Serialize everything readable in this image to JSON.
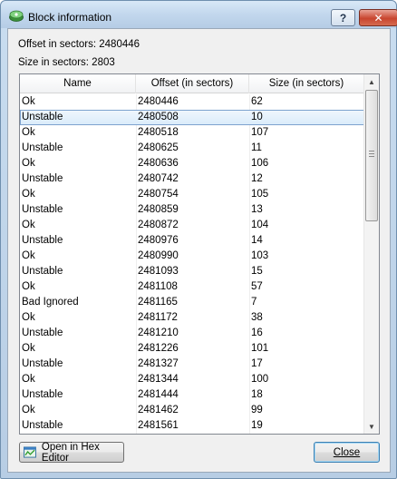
{
  "window": {
    "title": "Block information",
    "help_label": "?",
    "close_label": "✕"
  },
  "info": {
    "offset_line": "Offset in sectors: 2480446",
    "size_line": "Size in sectors: 2803"
  },
  "table": {
    "columns": [
      "Name",
      "Offset (in sectors)",
      "Size (in sectors)"
    ],
    "selected_row": 1,
    "rows": [
      [
        "Ok",
        "2480446",
        "62"
      ],
      [
        "Unstable",
        "2480508",
        "10"
      ],
      [
        "Ok",
        "2480518",
        "107"
      ],
      [
        "Unstable",
        "2480625",
        "11"
      ],
      [
        "Ok",
        "2480636",
        "106"
      ],
      [
        "Unstable",
        "2480742",
        "12"
      ],
      [
        "Ok",
        "2480754",
        "105"
      ],
      [
        "Unstable",
        "2480859",
        "13"
      ],
      [
        "Ok",
        "2480872",
        "104"
      ],
      [
        "Unstable",
        "2480976",
        "14"
      ],
      [
        "Ok",
        "2480990",
        "103"
      ],
      [
        "Unstable",
        "2481093",
        "15"
      ],
      [
        "Ok",
        "2481108",
        "57"
      ],
      [
        "Bad Ignored",
        "2481165",
        "7"
      ],
      [
        "Ok",
        "2481172",
        "38"
      ],
      [
        "Unstable",
        "2481210",
        "16"
      ],
      [
        "Ok",
        "2481226",
        "101"
      ],
      [
        "Unstable",
        "2481327",
        "17"
      ],
      [
        "Ok",
        "2481344",
        "100"
      ],
      [
        "Unstable",
        "2481444",
        "18"
      ],
      [
        "Ok",
        "2481462",
        "99"
      ],
      [
        "Unstable",
        "2481561",
        "19"
      ]
    ]
  },
  "buttons": {
    "hex_editor": "Open in Hex Editor",
    "close": "Close"
  },
  "icons": {
    "app": "disk-icon",
    "hex": "hex-editor-icon"
  },
  "colors": {
    "selection": "#cfe4f8",
    "titlebar": "#c2d7ed"
  }
}
